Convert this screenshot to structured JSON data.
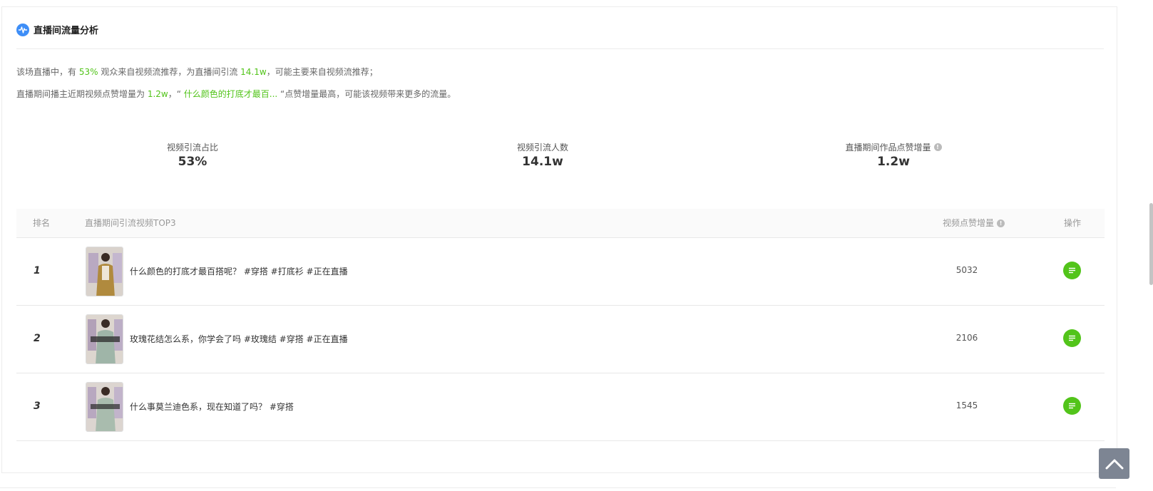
{
  "header": {
    "title": "直播间流量分析",
    "icon": "waveform-icon",
    "icon_color": "#3e8ef7"
  },
  "summary": {
    "line1": {
      "prefix": "该场直播中，有 ",
      "percent": "53%",
      "middle": " 观众来自视频流推荐，为直播间引流 ",
      "count": "14.1w",
      "suffix": "，可能主要来自视频流推荐；"
    },
    "line2": {
      "prefix": "直播期间播主近期视频点赞增量为 ",
      "likes": "1.2w",
      "middle": "，“ ",
      "video": "什么颜色的打底才最百...",
      "suffix": " “点赞增量最高，可能该视频带来更多的流量。"
    }
  },
  "stats": [
    {
      "label": "视频引流占比",
      "value": "53%",
      "info": false
    },
    {
      "label": "视频引流人数",
      "value": "14.1w",
      "info": false
    },
    {
      "label": "直播期间作品点赞增量",
      "value": "1.2w",
      "info": true
    }
  ],
  "table": {
    "headers": {
      "rank": "排名",
      "video": "直播期间引流视频TOP3",
      "likes": "视频点赞增量",
      "op": "操作"
    },
    "rows": [
      {
        "rank": "1",
        "title": "什么颜色的打底才最百搭呢？ #穿搭 #打底衫 #正在直播",
        "likes": "5032"
      },
      {
        "rank": "2",
        "title": "玫瑰花结怎么系，你学会了吗 #玫瑰结 #穿搭 #正在直播",
        "likes": "2106"
      },
      {
        "rank": "3",
        "title": "什么事莫兰迪色系，现在知道了吗？ #穿搭",
        "likes": "1545"
      }
    ]
  },
  "colors": {
    "accent_green": "#52c41a",
    "accent_blue": "#3e8ef7",
    "back_top": "#7d8593"
  },
  "icons": {
    "row_action": "list-detail-icon",
    "back_to_top": "chevron-up-icon",
    "info": "info-icon"
  }
}
